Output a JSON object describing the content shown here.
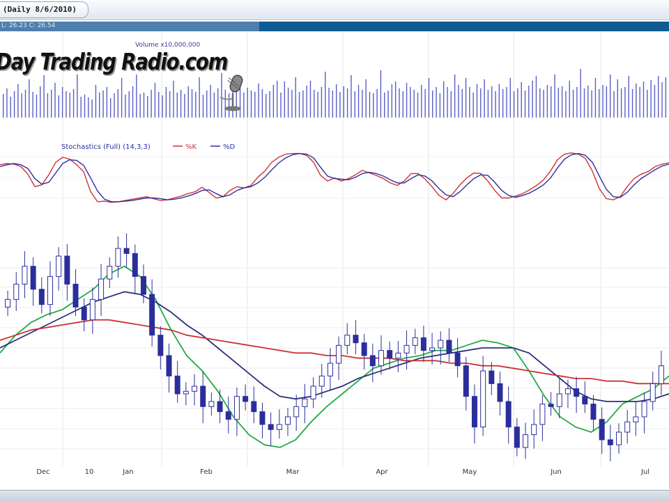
{
  "header": {
    "title": "(Daily 8/6/2010)",
    "quote_text": "L: 26.23  C: 26.54"
  },
  "logo": {
    "text": "Day Trading Radio.com"
  },
  "chart_data": {
    "type": "line",
    "x_labels": [
      "Dec",
      "10",
      "Jan",
      "Feb",
      "Mar",
      "Apr",
      "May",
      "Jun",
      "Jul"
    ],
    "panels": [
      {
        "name": "volume",
        "title": "Volume x10,000,000",
        "type": "bar",
        "values": [
          34,
          42,
          30,
          38,
          48,
          35,
          40,
          55,
          37,
          33,
          45,
          61,
          35,
          40,
          50,
          32,
          44,
          38,
          36,
          41,
          62,
          30,
          33,
          29,
          26,
          47,
          36,
          39,
          44,
          28,
          35,
          41,
          57,
          33,
          38,
          45,
          62,
          34,
          36,
          31,
          40,
          50,
          37,
          32,
          44,
          38,
          53,
          36,
          40,
          34,
          45,
          41,
          37,
          58,
          33,
          39,
          47,
          36,
          42,
          64,
          40,
          35,
          46,
          38,
          51,
          36,
          43,
          39,
          37,
          49,
          41,
          34,
          38,
          47,
          53,
          36,
          52,
          43,
          40,
          58,
          37,
          39,
          46,
          53,
          40,
          37,
          44,
          66,
          43,
          39,
          48,
          37,
          45,
          42,
          61,
          38,
          47,
          40,
          55,
          37,
          35,
          41,
          68,
          36,
          39,
          48,
          52,
          42,
          38,
          50,
          44,
          40,
          36,
          47,
          41,
          57,
          39,
          44,
          35,
          52,
          44,
          38,
          62,
          47,
          41,
          57,
          44,
          36,
          48,
          42,
          55,
          40,
          45,
          38,
          48,
          41,
          44,
          57,
          38,
          42,
          51,
          39,
          46,
          53,
          60,
          42,
          40,
          47,
          45,
          62,
          43,
          45,
          38,
          53,
          40,
          44,
          70,
          42,
          46,
          39,
          57,
          41,
          47,
          45,
          62,
          38,
          55,
          42,
          44,
          60,
          41,
          49,
          44,
          52,
          40,
          54,
          47,
          60,
          51,
          58
        ]
      },
      {
        "name": "stochastics",
        "title": "Stochastics (Full) (14,3,3)",
        "legend": [
          "%K",
          "%D"
        ],
        "colors": {
          "k": "#cc3333",
          "d": "#2c2fa0"
        },
        "series": [
          {
            "name": "%K",
            "values": [
              78,
              80,
              79,
              75,
              63,
              43,
              46,
              62,
              82,
              90,
              87,
              78,
              67,
              35,
              19,
              20,
              18,
              19,
              21,
              23,
              25,
              27,
              24,
              21,
              22,
              25,
              28,
              32,
              35,
              42,
              34,
              25,
              27,
              37,
              43,
              41,
              45,
              58,
              68,
              82,
              90,
              95,
              96,
              96,
              93,
              82,
              61,
              52,
              57,
              52,
              56,
              62,
              69,
              65,
              61,
              56,
              49,
              45,
              52,
              64,
              64,
              55,
              43,
              29,
              22,
              32,
              46,
              57,
              65,
              64,
              52,
              37,
              25,
              25,
              28,
              32,
              38,
              45,
              54,
              68,
              86,
              95,
              97,
              95,
              88,
              68,
              40,
              24,
              22,
              27,
              43,
              56,
              63,
              67,
              75,
              79,
              81
            ]
          },
          {
            "name": "%D",
            "values": [
              75,
              78,
              80,
              78,
              72,
              56,
              47,
              50,
              65,
              80,
              86,
              85,
              77,
              57,
              36,
              23,
              19,
              19,
              20,
              21,
              23,
              25,
              25,
              24,
              22,
              23,
              25,
              28,
              32,
              37,
              38,
              32,
              27,
              30,
              37,
              41,
              43,
              49,
              58,
              70,
              81,
              89,
              94,
              96,
              95,
              89,
              74,
              60,
              56,
              55,
              54,
              58,
              64,
              66,
              64,
              60,
              54,
              49,
              49,
              56,
              62,
              60,
              52,
              40,
              30,
              27,
              35,
              46,
              56,
              62,
              61,
              50,
              37,
              29,
              26,
              29,
              33,
              39,
              46,
              57,
              73,
              87,
              94,
              96,
              93,
              82,
              60,
              39,
              27,
              26,
              34,
              46,
              56,
              63,
              70,
              76,
              79
            ]
          }
        ],
        "ylim": [
          0,
          100
        ]
      },
      {
        "name": "price",
        "type": "candlestick",
        "ma_colors": {
          "short": "#22aa44",
          "mid": "#2c2f7a",
          "long": "#cc3333"
        },
        "moving_averages": [
          {
            "name": "short",
            "values": [
              26.3,
              27.0,
              27.5,
              27.8,
              28.0,
              28.4,
              28.8,
              29.4,
              29.7,
              29.3,
              28.4,
              27.2,
              26.2,
              25.6,
              24.8,
              23.8,
              23.1,
              22.7,
              22.6,
              22.9,
              23.6,
              24.2,
              24.7,
              25.2,
              25.7,
              25.9,
              26.1,
              26.2,
              26.4,
              26.4,
              26.6,
              26.8,
              26.7,
              26.5,
              25.6,
              24.6,
              23.8,
              23.4,
              23.2,
              23.6,
              24.3,
              24.6,
              24.9,
              25.4
            ]
          },
          {
            "name": "mid",
            "values": [
              26.5,
              26.8,
              27.1,
              27.4,
              27.7,
              28.0,
              28.3,
              28.5,
              28.7,
              28.6,
              28.3,
              27.9,
              27.4,
              27.0,
              26.5,
              26.0,
              25.5,
              25.0,
              24.6,
              24.5,
              24.6,
              24.8,
              25.0,
              25.3,
              25.5,
              25.7,
              25.9,
              26.1,
              26.2,
              26.3,
              26.4,
              26.5,
              26.5,
              26.5,
              26.3,
              25.8,
              25.3,
              24.8,
              24.5,
              24.4,
              24.4,
              24.4,
              24.5,
              24.7
            ]
          },
          {
            "name": "long",
            "values": [
              26.8,
              27.0,
              27.2,
              27.3,
              27.4,
              27.5,
              27.6,
              27.6,
              27.5,
              27.4,
              27.3,
              27.2,
              27.0,
              26.9,
              26.8,
              26.7,
              26.6,
              26.5,
              26.4,
              26.3,
              26.3,
              26.2,
              26.2,
              26.1,
              26.1,
              26.1,
              26.0,
              26.0,
              26.0,
              25.9,
              25.9,
              25.8,
              25.8,
              25.7,
              25.6,
              25.5,
              25.4,
              25.3,
              25.3,
              25.2,
              25.2,
              25.1,
              25.1,
              25.1
            ]
          }
        ],
        "closes": [
          28.4,
          29.0,
          29.7,
          28.8,
          28.2,
          29.3,
          30.1,
          29.0,
          28.1,
          27.6,
          28.4,
          29.2,
          29.7,
          30.4,
          30.2,
          29.3,
          28.6,
          27.0,
          26.2,
          25.4,
          24.7,
          24.8,
          25.0,
          24.2,
          24.4,
          24.0,
          23.7,
          24.6,
          24.4,
          24.0,
          23.5,
          23.3,
          23.5,
          23.8,
          24.2,
          24.5,
          25.0,
          25.4,
          25.9,
          26.6,
          27.0,
          26.7,
          26.2,
          25.8,
          26.4,
          26.1,
          26.3,
          26.6,
          26.9,
          26.4,
          26.5,
          26.8,
          26.3,
          25.8,
          24.6,
          23.4,
          25.6,
          25.1,
          24.4,
          23.4,
          22.6,
          23.1,
          23.5,
          24.3,
          24.2,
          24.7,
          24.9,
          24.6,
          24.3,
          23.7,
          22.9,
          22.7,
          23.2,
          23.6,
          23.8,
          24.4,
          25.1,
          25.8
        ]
      }
    ]
  }
}
